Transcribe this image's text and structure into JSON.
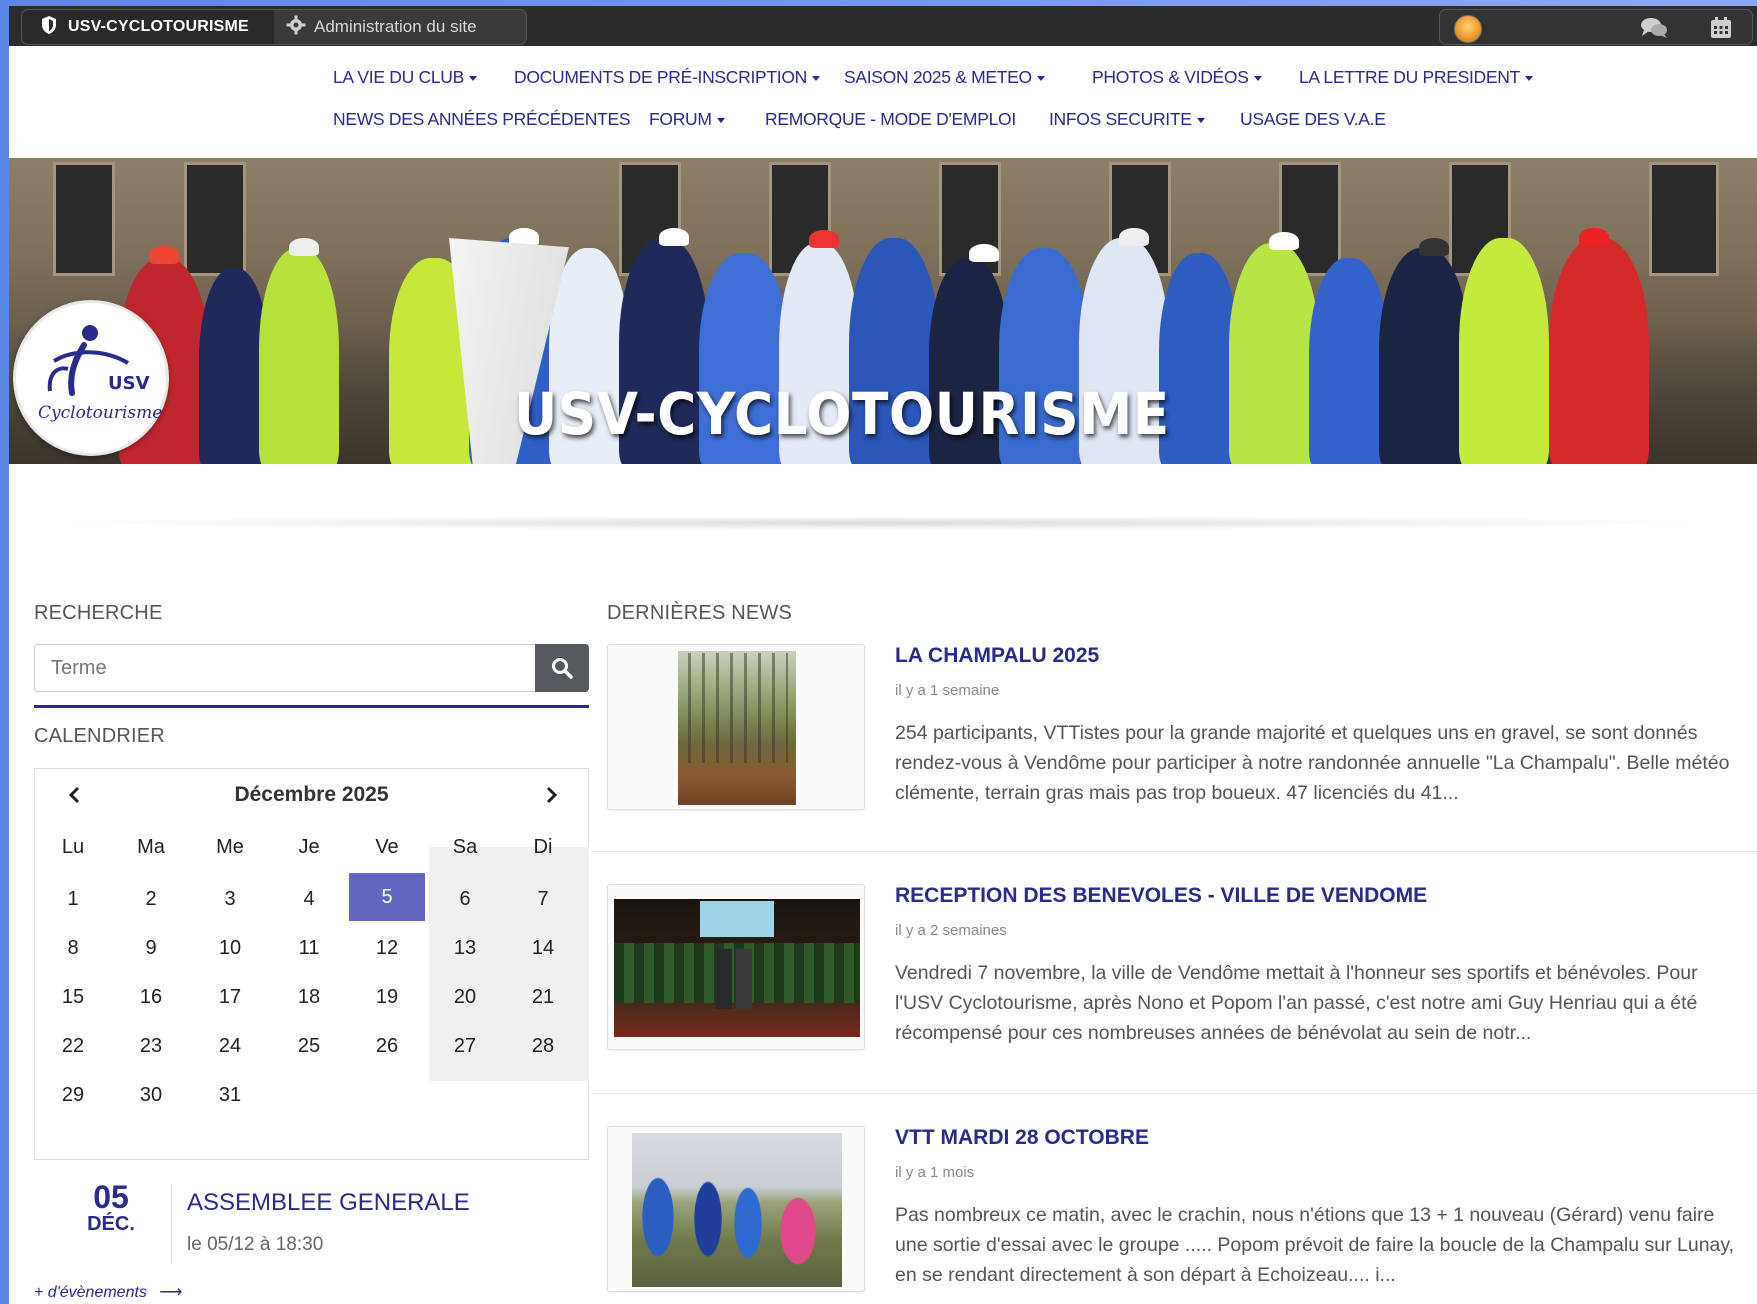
{
  "adminbar": {
    "site_name": "USV-CYCLOTOURISME",
    "admin_label": "Administration du site"
  },
  "nav": {
    "row1": [
      {
        "label": "LA VIE DU CLUB",
        "dropdown": true
      },
      {
        "label": "DOCUMENTS DE PRÉ-INSCRIPTION",
        "dropdown": true
      },
      {
        "label": "SAISON 2025 & METEO",
        "dropdown": true
      },
      {
        "label": "PHOTOS & VIDÉOS",
        "dropdown": true
      },
      {
        "label": "LA LETTRE DU PRESIDENT",
        "dropdown": true
      }
    ],
    "row2": [
      {
        "label": "NEWS DES ANNÉES PRÉCÉDENTES",
        "dropdown": false
      },
      {
        "label": "FORUM",
        "dropdown": true
      },
      {
        "label": "REMORQUE - MODE D'EMPLOI",
        "dropdown": false
      },
      {
        "label": "INFOS SECURITE",
        "dropdown": true
      },
      {
        "label": "USAGE DES V.A.E",
        "dropdown": false
      }
    ]
  },
  "banner": {
    "title": "USV-CYCLOTOURISME",
    "logo_abbrev": "USV",
    "logo_text": "Cyclotourisme"
  },
  "sidebar": {
    "search_title": "RECHERCHE",
    "search_placeholder": "Terme",
    "calendar_title": "CALENDRIER",
    "calendar": {
      "month_label": "Décembre 2025",
      "weekdays": [
        "Lu",
        "Ma",
        "Me",
        "Je",
        "Ve",
        "Sa",
        "Di"
      ],
      "weeks": [
        [
          "1",
          "2",
          "3",
          "4",
          "5",
          "6",
          "7"
        ],
        [
          "8",
          "9",
          "10",
          "11",
          "12",
          "13",
          "14"
        ],
        [
          "15",
          "16",
          "17",
          "18",
          "19",
          "20",
          "21"
        ],
        [
          "22",
          "23",
          "24",
          "25",
          "26",
          "27",
          "28"
        ],
        [
          "29",
          "30",
          "31",
          "",
          "",
          "",
          ""
        ]
      ],
      "today": "5"
    },
    "event": {
      "day": "05",
      "month": "DÉC.",
      "title": "ASSEMBLEE GENERALE",
      "time": "le 05/12 à 18:30"
    },
    "more_events": "+ d'évènements"
  },
  "news": {
    "section_title": "DERNIÈRES NEWS",
    "items": [
      {
        "title": "LA CHAMPALU 2025",
        "time": "il y a 1 semaine",
        "excerpt": "254 participants, VTTistes pour la grande majorité et quelques uns en gravel, se sont donnés rendez-vous à Vendôme pour participer à notre randonnée annuelle \"La Champalu\". Belle météo clémente, terrain gras mais pas trop boueux.  47 licenciés du 41..."
      },
      {
        "title": "RECEPTION DES BENEVOLES - VILLE DE VENDOME",
        "time": "il y a 2 semaines",
        "excerpt": "Vendredi 7 novembre, la ville de Vendôme mettait à l'honneur ses sportifs et bénévoles. Pour l'USV Cyclotourisme, après Nono et Popom l'an passé, c'est notre ami Guy Henriau qui a été récompensé pour ces nombreuses années de bénévolat au sein de notr..."
      },
      {
        "title": "VTT MARDI 28 OCTOBRE",
        "time": "il y a 1 mois",
        "excerpt": "Pas nombreux ce matin, avec le crachin, nous n'étions que 13 + 1 nouveau (Gérard) venu faire une sortie d'essai avec le groupe .....  Popom prévoit de faire la boucle de la Champalu sur Lunay, en se rendant directement à son départ à Echoizeau.... i..."
      }
    ]
  },
  "colors": {
    "accent": "#2a2a8c",
    "today_highlight": "#6366c0",
    "adminbar": "#2c2c2c",
    "search_button": "#555a61"
  }
}
